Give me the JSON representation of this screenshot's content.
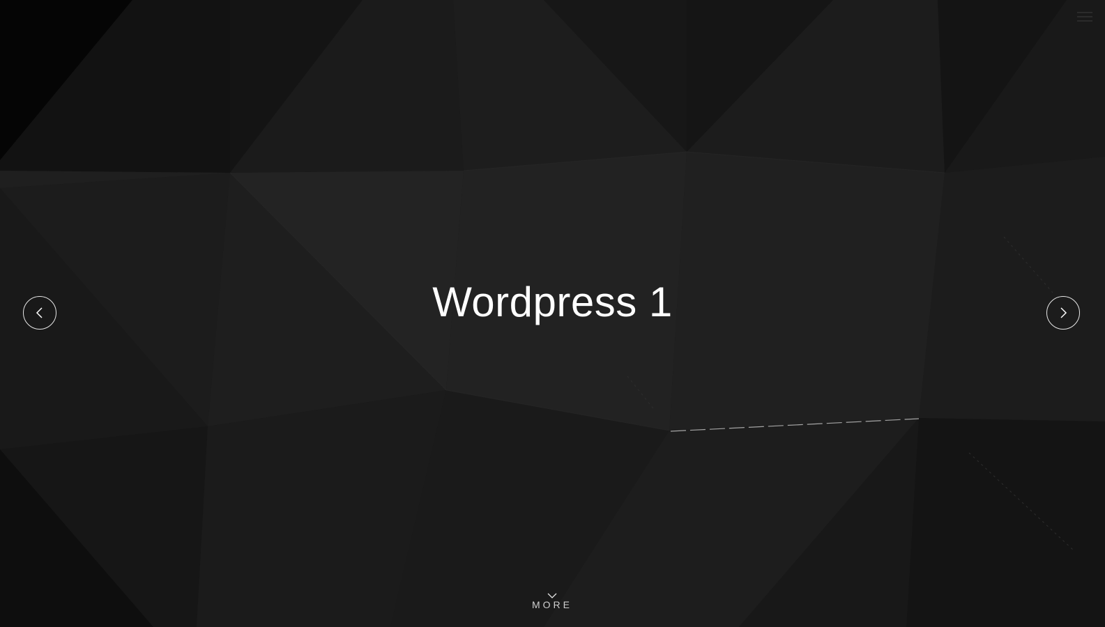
{
  "slide": {
    "title": "Wordpress 1"
  },
  "navigation": {
    "prev_icon": "chevron-left-icon",
    "next_icon": "chevron-right-icon",
    "menu_icon": "hamburger-menu-icon"
  },
  "scroll_hint": {
    "label": "MORE",
    "icon": "chevron-down-icon"
  },
  "colors": {
    "background": "#1a1a1a",
    "text": "#ffffff",
    "accent_line": "#bfbfbf"
  }
}
